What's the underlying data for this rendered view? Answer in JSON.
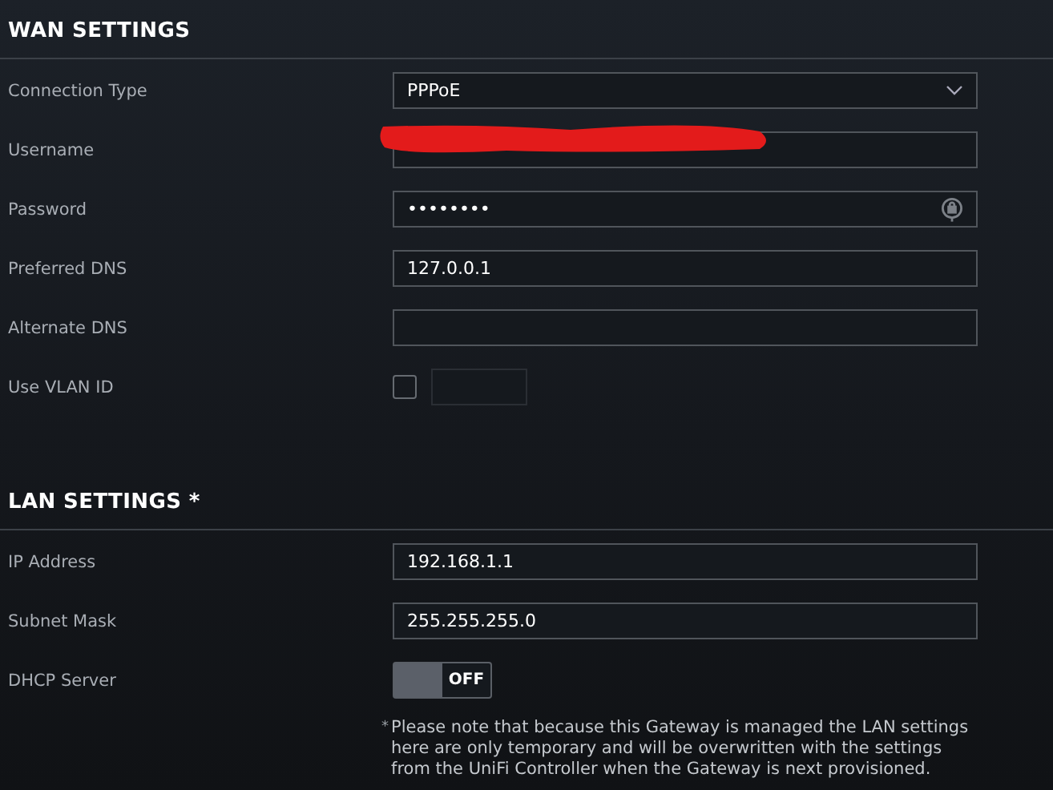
{
  "sections": [
    {
      "title": "WAN SETTINGS",
      "rows": [
        {
          "kind": "select",
          "label": "Connection Type",
          "value": "PPPoE"
        },
        {
          "kind": "redacted",
          "label": "Username"
        },
        {
          "kind": "password",
          "label": "Password",
          "value": "••••••••"
        },
        {
          "kind": "text",
          "label": "Preferred DNS",
          "value": "127.0.0.1"
        },
        {
          "kind": "text",
          "label": "Alternate DNS"
        },
        {
          "kind": "checkfield",
          "label": "Use VLAN ID",
          "checked": false
        }
      ]
    },
    {
      "title": "LAN SETTINGS *",
      "rows": [
        {
          "kind": "text",
          "label": "IP Address",
          "value": "192.168.1.1"
        },
        {
          "kind": "text",
          "label": "Subnet Mask",
          "value": "255.255.255.0"
        },
        {
          "kind": "toggle",
          "label": "DHCP Server",
          "on": false,
          "state_text": "OFF"
        }
      ],
      "note_mark": "*",
      "note": "Please note that because this Gateway is managed the LAN settings here are only temporary and will be overwritten with the settings from the UniFi Controller when the Gateway is next provisioned."
    }
  ]
}
